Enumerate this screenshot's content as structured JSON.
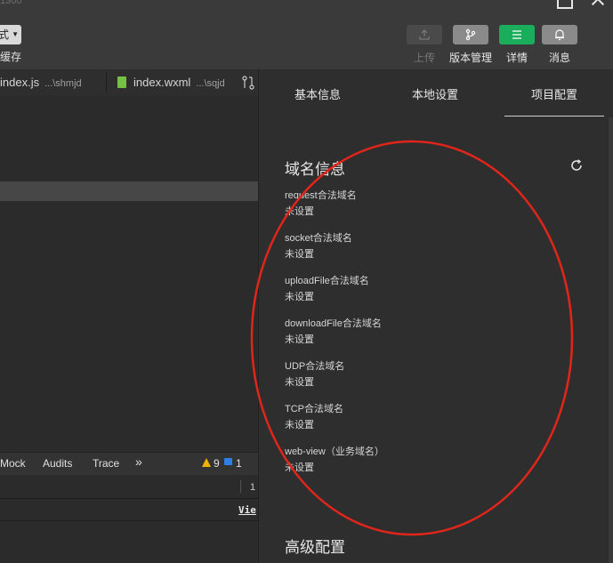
{
  "window": {
    "title_fragment": "1300"
  },
  "toolbar": {
    "compile_mode_short": "式",
    "clear_cache_label": "缓存",
    "upload_label": "上传",
    "version_label": "版本管理",
    "details_label": "详情",
    "messages_label": "消息"
  },
  "file_tabs": [
    {
      "name": "index.js",
      "path": "...\\shmjd"
    },
    {
      "name": "index.wxml",
      "path": "...\\sqjd"
    }
  ],
  "devtools": {
    "tabs": [
      "Mock",
      "Audits",
      "Trace"
    ],
    "more": "»",
    "warnings": "9",
    "infos": "1",
    "console_line": "1",
    "view_link": "Vie"
  },
  "panel": {
    "tabs": [
      "基本信息",
      "本地设置",
      "项目配置"
    ],
    "active_tab": "项目配置",
    "domain_section_title": "域名信息",
    "domains": [
      {
        "label": "request合法域名",
        "value": "未设置"
      },
      {
        "label": "socket合法域名",
        "value": "未设置"
      },
      {
        "label": "uploadFile合法域名",
        "value": "未设置"
      },
      {
        "label": "downloadFile合法域名",
        "value": "未设置"
      },
      {
        "label": "UDP合法域名",
        "value": "未设置"
      },
      {
        "label": "TCP合法域名",
        "value": "未设置"
      },
      {
        "label": "web-view（业务域名）",
        "value": "未设置"
      }
    ],
    "advanced_section_title": "高级配置"
  },
  "colors": {
    "accent_green": "#1aad5b",
    "annotation_red": "#e0251b",
    "warning_yellow": "#f0b400",
    "info_blue": "#2f7fe3"
  }
}
